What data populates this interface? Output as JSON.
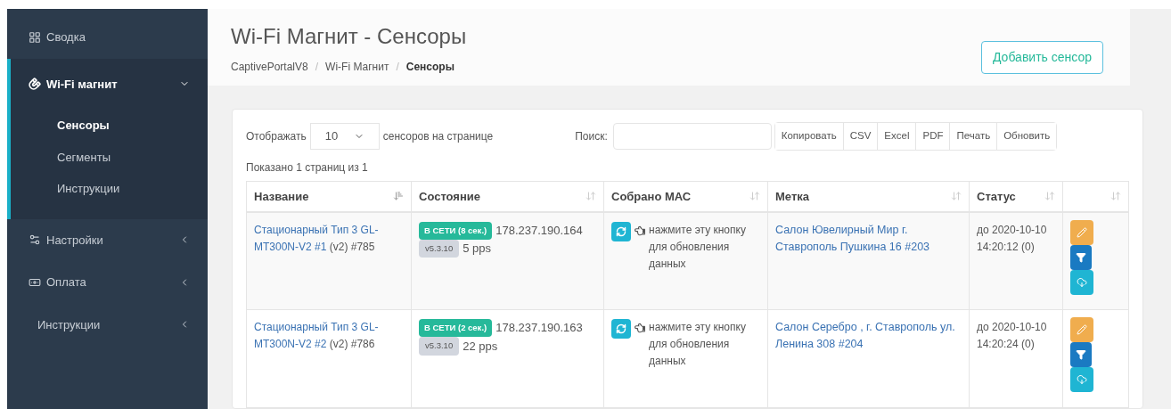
{
  "sidebar": {
    "items": [
      {
        "label": "Сводка",
        "kind": "dashboard",
        "expanded": false
      },
      {
        "label": "Wi-Fi магнит",
        "kind": "magnet",
        "expanded": true,
        "children": [
          {
            "label": "Сенсоры",
            "selected": true
          },
          {
            "label": "Сегменты",
            "selected": false
          },
          {
            "label": "Инструкции",
            "selected": false
          }
        ]
      },
      {
        "label": "Настройки",
        "kind": "settings",
        "expanded": false
      },
      {
        "label": "Оплата",
        "kind": "payment",
        "expanded": false
      },
      {
        "label": "Инструкции",
        "kind": "docs",
        "expanded": false
      }
    ]
  },
  "page": {
    "title": "Wi-Fi Магнит - Сенсоры",
    "breadcrumbs": [
      "CaptivePortalV8",
      "Wi-Fi Магнит",
      "Сенсоры"
    ],
    "breadcrumb_separator": "/",
    "add_button": "Добавить сенсор"
  },
  "table_controls": {
    "show_label": "Отображать",
    "page_size": "10",
    "show_suffix": "сенсоров на странице",
    "search_label": "Поиск:",
    "export_buttons": [
      "Копировать",
      "CSV",
      "Excel",
      "PDF",
      "Печать",
      "Обновить"
    ],
    "info": "Показано 1 страниц из 1"
  },
  "table": {
    "columns": [
      {
        "label": "Название",
        "sorted": true
      },
      {
        "label": "Состояние",
        "sorted": false
      },
      {
        "label": "Собрано МАС",
        "sorted": false
      },
      {
        "label": "Метка",
        "sorted": false
      },
      {
        "label": "Статус",
        "sorted": false
      },
      {
        "sorted": false
      }
    ],
    "rows": [
      {
        "name": "Стационарный Тип 3 GL-MT300N-V2 #1",
        "name_suffix": "(v2) #785",
        "badge": "В СЕТИ (8 сек.)",
        "ip": "178.237.190.164",
        "version": "v5.3.10",
        "pps": "5 pps",
        "mac_hint": "нажмите эту кнопку для обновления данных",
        "label": "Салон Ювелирный Мир г. Ставрополь Пушкина 16 #203",
        "status": "до 2020-10-10 14:20:12 (0)"
      },
      {
        "name": "Стационарный Тип 3 GL-MT300N-V2 #2",
        "name_suffix": "(v2) #786",
        "badge": "В СЕТИ (2 сек.)",
        "ip": "178.237.190.163",
        "version": "v5.3.10",
        "pps": "22 pps",
        "mac_hint": "нажмите эту кнопку для обновления данных",
        "label": "Салон Серебро , г. Ставрополь ул. Ленина 308 #204",
        "status": "до 2020-10-10 14:20:24 (0)"
      }
    ]
  }
}
